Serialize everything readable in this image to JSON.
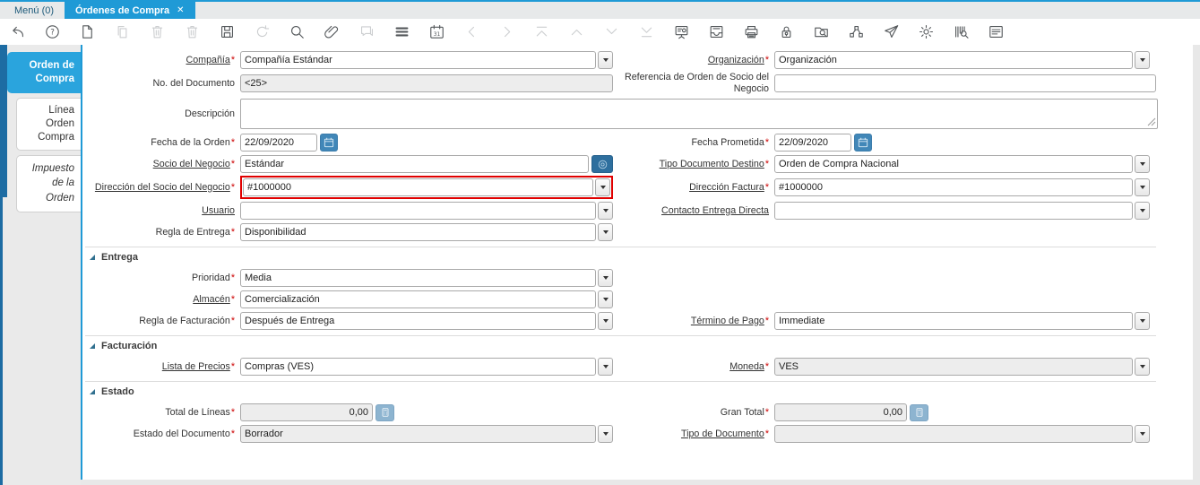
{
  "colors": {
    "accent": "#1f9ad6",
    "sidebar_accent": "#1d6ca3",
    "active_sidebar_tab": "#2aa4dd",
    "required_asterisk": "#cc0000",
    "focus_border": "#e00000",
    "readonly_field": "#ededed"
  },
  "icons": {
    "close": "✕"
  },
  "window_tabs": {
    "menu": {
      "label": "Menú (0)"
    },
    "active": {
      "label": "Órdenes de Compra"
    }
  },
  "toolbar": {
    "items": [
      {
        "icon": "undo",
        "disabled": false
      },
      {
        "icon": "help",
        "disabled": false
      },
      {
        "icon": "new-record",
        "disabled": false
      },
      {
        "icon": "copy-record",
        "disabled": true
      },
      {
        "icon": "delete-record",
        "disabled": true
      },
      {
        "icon": "delete-selection",
        "disabled": true
      },
      {
        "icon": "save",
        "disabled": false
      },
      {
        "icon": "refresh",
        "disabled": true
      },
      {
        "icon": "find",
        "disabled": false
      },
      {
        "icon": "attachment",
        "disabled": false
      },
      {
        "icon": "chat",
        "disabled": true
      },
      {
        "icon": "grid-toggle",
        "disabled": false
      },
      {
        "icon": "calendar",
        "disabled": false
      },
      {
        "icon": "nav-previous",
        "disabled": true
      },
      {
        "icon": "nav-next",
        "disabled": true
      },
      {
        "icon": "nav-first",
        "disabled": true
      },
      {
        "icon": "nav-up",
        "disabled": true
      },
      {
        "icon": "nav-down",
        "disabled": true
      },
      {
        "icon": "nav-last",
        "disabled": true
      },
      {
        "icon": "report",
        "disabled": false
      },
      {
        "icon": "archive",
        "disabled": false
      },
      {
        "icon": "print",
        "disabled": false
      },
      {
        "icon": "lock",
        "disabled": false
      },
      {
        "icon": "zoom-across",
        "disabled": false
      },
      {
        "icon": "workflow",
        "disabled": false
      },
      {
        "icon": "send-mail",
        "disabled": false
      },
      {
        "icon": "preferences",
        "disabled": false
      },
      {
        "icon": "product-info",
        "disabled": false
      },
      {
        "icon": "quick-form",
        "disabled": false
      }
    ]
  },
  "sidebar": {
    "tabs": [
      {
        "label": "Orden de Compra",
        "active": true
      },
      {
        "label": "Línea Orden Compra",
        "active": false
      },
      {
        "label": "Impuesto de la Orden",
        "active": false
      }
    ]
  },
  "form": {
    "required_marker": "*",
    "sections": {
      "entrega": "Entrega",
      "facturacion": "Facturación",
      "estado": "Estado"
    },
    "fields": {
      "compania": {
        "label": "Compañía",
        "value": "Compañía Estándar"
      },
      "organizacion": {
        "label": "Organización",
        "value": "Organización"
      },
      "no_documento": {
        "label": "No. del Documento",
        "value": "<25>"
      },
      "referencia": {
        "label": "Referencia de Orden de Socio del Negocio",
        "value": ""
      },
      "descripcion": {
        "label": "Descripción",
        "value": ""
      },
      "fecha_orden": {
        "label": "Fecha de la Orden",
        "value": "22/09/2020"
      },
      "fecha_prometida": {
        "label": "Fecha Prometida",
        "value": "22/09/2020"
      },
      "socio": {
        "label": "Socio del Negocio",
        "value": "Estándar"
      },
      "tipo_doc_destino": {
        "label": "Tipo Documento Destino",
        "value": "Orden de Compra Nacional"
      },
      "direccion_socio": {
        "label": "Dirección del Socio del Negocio",
        "value": "#1000000"
      },
      "direccion_factura": {
        "label": "Dirección Factura",
        "value": "#1000000"
      },
      "usuario": {
        "label": "Usuario",
        "value": ""
      },
      "contacto": {
        "label": "Contacto Entrega Directa",
        "value": ""
      },
      "regla_entrega": {
        "label": "Regla de Entrega",
        "value": "Disponibilidad"
      },
      "prioridad": {
        "label": "Prioridad",
        "value": "Media"
      },
      "almacen": {
        "label": "Almacén",
        "value": "Comercialización"
      },
      "regla_facturacion": {
        "label": "Regla de Facturación",
        "value": "Después de Entrega"
      },
      "termino_pago": {
        "label": "Término de Pago",
        "value": "Immediate"
      },
      "lista_precios": {
        "label": "Lista de Precios",
        "value": "Compras (VES)"
      },
      "moneda": {
        "label": "Moneda",
        "value": "VES"
      },
      "total_lineas": {
        "label": "Total de Líneas",
        "value": "0,00"
      },
      "gran_total": {
        "label": "Gran Total",
        "value": "0,00"
      },
      "estado_documento": {
        "label": "Estado del Documento",
        "value": "Borrador"
      },
      "tipo_documento": {
        "label": "Tipo de Documento",
        "value": ""
      }
    }
  }
}
